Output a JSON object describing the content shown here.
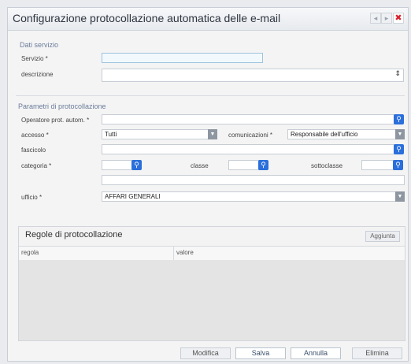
{
  "window": {
    "title": "Configurazione protocollazione automatica delle e-mail",
    "controls": [
      "◂",
      "▸",
      "✖"
    ]
  },
  "servizio_section": {
    "title": "Dati servizio",
    "servizio_label": "Servizio *",
    "servizio_value": "",
    "descrizione_label": "descrizione",
    "descrizione_value": ""
  },
  "params": {
    "title": "Parametri di protocollazione",
    "operatore_label": "Operatore prot. autom. *",
    "operatore_value": "",
    "accesso_label": "accesso *",
    "accesso_value": "Tutti",
    "comunicazioni_label": "comunicazioni *",
    "comunicazioni_value": "Responsabile dell'ufficio",
    "fascicolo_label": "fascicolo",
    "fascicolo_value": "",
    "categoria_label": "categoria *",
    "categoria_value": "",
    "classe_label": "classe",
    "classe_value": "",
    "sottoclasse_label": "sottoclasse",
    "sottoclasse_value": "",
    "extra_value": "",
    "ufficio_label": "ufficio *",
    "ufficio_value": "AFFARI GENERALI"
  },
  "rules": {
    "title": "Regole di protocollazione",
    "add_label": "Aggiunta",
    "col_regola": "regola",
    "col_valore": "valore"
  },
  "footer": {
    "modifica": "Modifica",
    "salva": "Salva",
    "annulla": "Annulla",
    "elimina": "Elimina"
  }
}
